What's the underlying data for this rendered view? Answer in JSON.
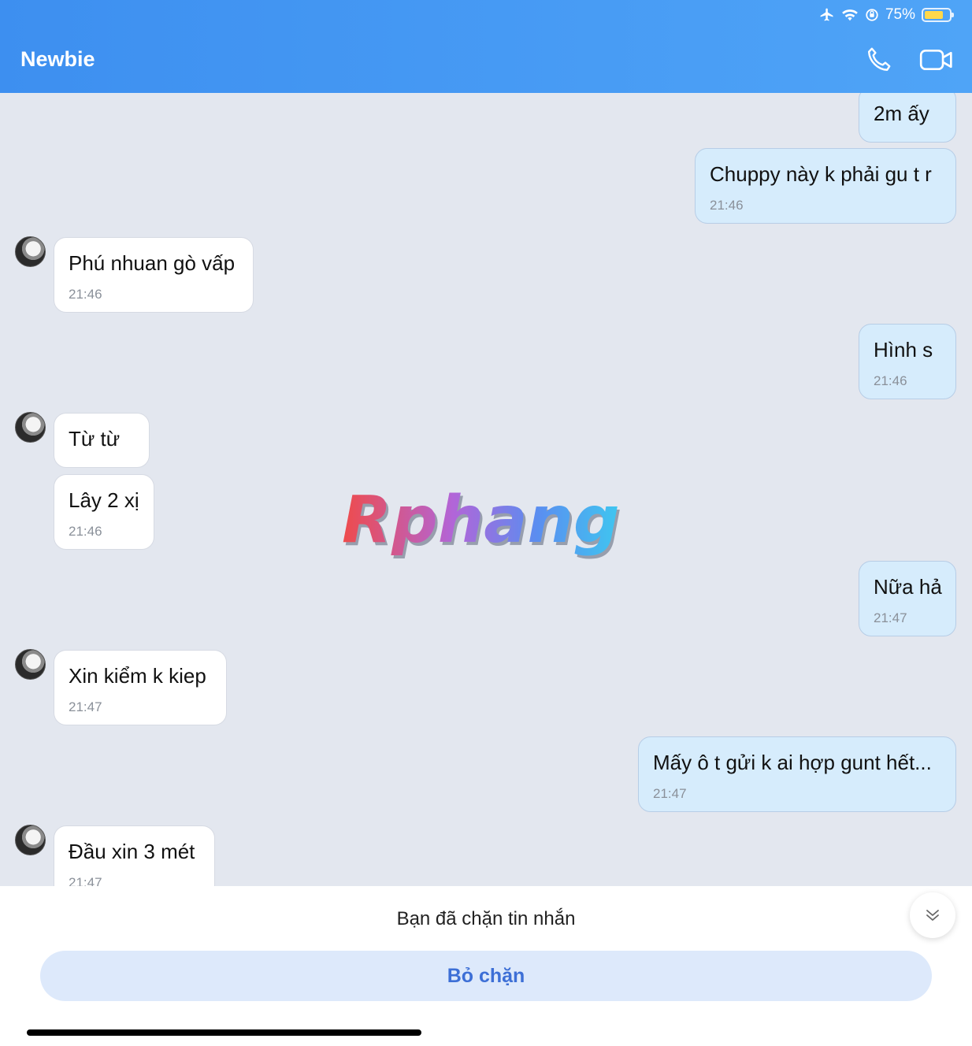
{
  "status_bar": {
    "battery": "75%",
    "battery_level": 0.75,
    "icons": [
      "airplane-icon",
      "wifi-icon",
      "orientation-lock-icon",
      "battery-icon"
    ]
  },
  "header": {
    "title": "Newbie",
    "icons": [
      "phone-icon",
      "video-call-icon"
    ]
  },
  "messages": [
    {
      "side": "out",
      "text": "2m ấy"
    },
    {
      "side": "out",
      "text": "Chuppy này k phải gu t r",
      "time": "21:46"
    },
    {
      "side": "in",
      "text": "Phú nhuan gò vấp",
      "time": "21:46"
    },
    {
      "side": "out",
      "text": "Hình s",
      "time": "21:46"
    },
    {
      "side": "in",
      "text": "Từ từ"
    },
    {
      "side": "in",
      "text": "Lây 2 xị",
      "time": "21:46"
    },
    {
      "side": "out",
      "text": "Nữa hả",
      "time": "21:47"
    },
    {
      "side": "in",
      "text": "Xin kiểm k kiep",
      "time": "21:47"
    },
    {
      "side": "out",
      "text": "Mấy ô t gửi k ai hợp gunt hết...",
      "time": "21:47"
    },
    {
      "side": "in",
      "text": "Đầu xin 3 mét",
      "time": "21:47"
    }
  ],
  "watermark": "Rphang",
  "footer": {
    "blocked_notice": "Bạn đã chặn tin nhắn",
    "unblock_label": "Bỏ chặn"
  },
  "colors": {
    "header": "#4a9bf5",
    "chat_bg": "#e3e7ef",
    "outgoing": "#d6ecfc",
    "incoming": "#ffffff",
    "accent": "#3d6fd6"
  }
}
